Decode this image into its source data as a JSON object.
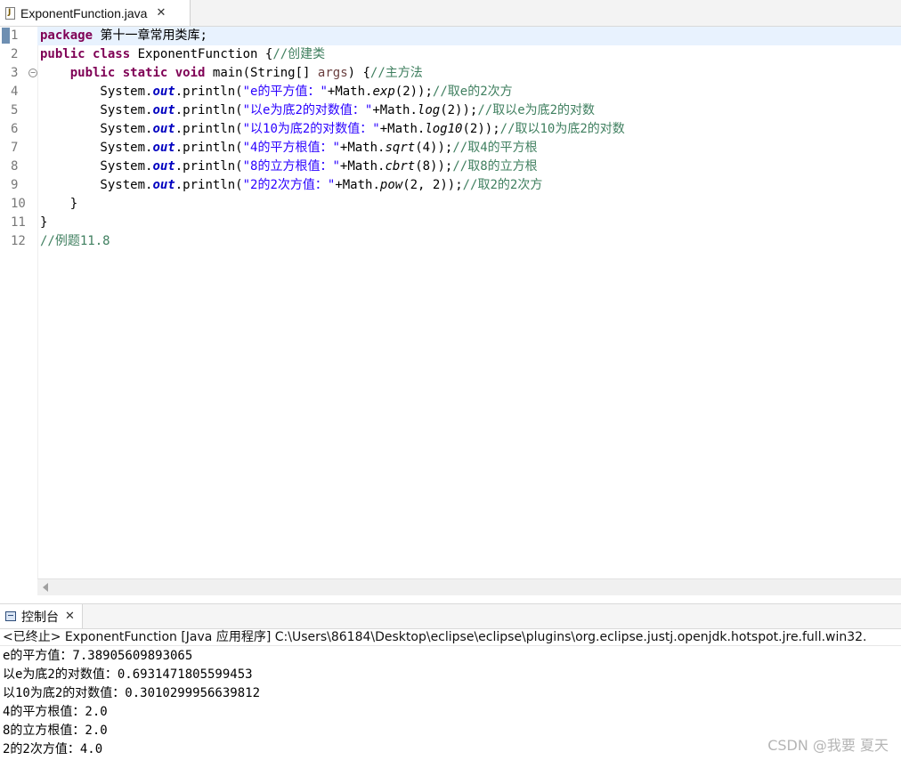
{
  "editor_tab": {
    "title": "ExponentFunction.java",
    "close": "✕"
  },
  "code_lines": [
    {
      "num": "1",
      "parts": [
        {
          "t": "package",
          "c": "kw"
        },
        {
          "t": " 第十一章常用类库;",
          "c": ""
        }
      ]
    },
    {
      "num": "2",
      "parts": [
        {
          "t": "public",
          "c": "kw"
        },
        {
          "t": " ",
          "c": ""
        },
        {
          "t": "class",
          "c": "kw"
        },
        {
          "t": " ExponentFunction {",
          "c": ""
        },
        {
          "t": "//创建类",
          "c": "cm"
        }
      ]
    },
    {
      "num": "3",
      "fold": true,
      "parts": [
        {
          "t": "    ",
          "c": ""
        },
        {
          "t": "public",
          "c": "kw"
        },
        {
          "t": " ",
          "c": ""
        },
        {
          "t": "static",
          "c": "kw"
        },
        {
          "t": " ",
          "c": ""
        },
        {
          "t": "void",
          "c": "kw"
        },
        {
          "t": " main(String[] ",
          "c": ""
        },
        {
          "t": "args",
          "c": "ar"
        },
        {
          "t": ") {",
          "c": ""
        },
        {
          "t": "//主方法",
          "c": "cm"
        }
      ]
    },
    {
      "num": "4",
      "parts": [
        {
          "t": "        System.",
          "c": ""
        },
        {
          "t": "out",
          "c": "fld"
        },
        {
          "t": ".println(",
          "c": ""
        },
        {
          "t": "\"e的平方值：\"",
          "c": "st"
        },
        {
          "t": "+Math.",
          "c": ""
        },
        {
          "t": "exp",
          "c": "it"
        },
        {
          "t": "(2));",
          "c": ""
        },
        {
          "t": "//取e的2次方",
          "c": "cm"
        }
      ]
    },
    {
      "num": "5",
      "parts": [
        {
          "t": "        System.",
          "c": ""
        },
        {
          "t": "out",
          "c": "fld"
        },
        {
          "t": ".println(",
          "c": ""
        },
        {
          "t": "\"以e为底2的对数值：\"",
          "c": "st"
        },
        {
          "t": "+Math.",
          "c": ""
        },
        {
          "t": "log",
          "c": "it"
        },
        {
          "t": "(2));",
          "c": ""
        },
        {
          "t": "//取以e为底2的对数",
          "c": "cm"
        }
      ]
    },
    {
      "num": "6",
      "parts": [
        {
          "t": "        System.",
          "c": ""
        },
        {
          "t": "out",
          "c": "fld"
        },
        {
          "t": ".println(",
          "c": ""
        },
        {
          "t": "\"以10为底2的对数值：\"",
          "c": "st"
        },
        {
          "t": "+Math.",
          "c": ""
        },
        {
          "t": "log10",
          "c": "it"
        },
        {
          "t": "(2));",
          "c": ""
        },
        {
          "t": "//取以10为底2的对数",
          "c": "cm"
        }
      ]
    },
    {
      "num": "7",
      "parts": [
        {
          "t": "        System.",
          "c": ""
        },
        {
          "t": "out",
          "c": "fld"
        },
        {
          "t": ".println(",
          "c": ""
        },
        {
          "t": "\"4的平方根值：\"",
          "c": "st"
        },
        {
          "t": "+Math.",
          "c": ""
        },
        {
          "t": "sqrt",
          "c": "it"
        },
        {
          "t": "(4));",
          "c": ""
        },
        {
          "t": "//取4的平方根",
          "c": "cm"
        }
      ]
    },
    {
      "num": "8",
      "parts": [
        {
          "t": "        System.",
          "c": ""
        },
        {
          "t": "out",
          "c": "fld"
        },
        {
          "t": ".println(",
          "c": ""
        },
        {
          "t": "\"8的立方根值：\"",
          "c": "st"
        },
        {
          "t": "+Math.",
          "c": ""
        },
        {
          "t": "cbrt",
          "c": "it"
        },
        {
          "t": "(8));",
          "c": ""
        },
        {
          "t": "//取8的立方根",
          "c": "cm"
        }
      ]
    },
    {
      "num": "9",
      "parts": [
        {
          "t": "        System.",
          "c": ""
        },
        {
          "t": "out",
          "c": "fld"
        },
        {
          "t": ".println(",
          "c": ""
        },
        {
          "t": "\"2的2次方值：\"",
          "c": "st"
        },
        {
          "t": "+Math.",
          "c": ""
        },
        {
          "t": "pow",
          "c": "it"
        },
        {
          "t": "(2, 2));",
          "c": ""
        },
        {
          "t": "//取2的2次方",
          "c": "cm"
        }
      ]
    },
    {
      "num": "10",
      "parts": [
        {
          "t": "    }",
          "c": ""
        }
      ]
    },
    {
      "num": "11",
      "parts": [
        {
          "t": "}",
          "c": ""
        }
      ]
    },
    {
      "num": "12",
      "parts": [
        {
          "t": "//例题11.8",
          "c": "cm"
        }
      ]
    }
  ],
  "console": {
    "tab_label": "控制台",
    "close": "✕",
    "description": "<已终止> ExponentFunction [Java 应用程序] C:\\Users\\86184\\Desktop\\eclipse\\eclipse\\plugins\\org.eclipse.justj.openjdk.hotspot.jre.full.win32.",
    "output": [
      "e的平方值：7.38905609893065",
      "以e为底2的对数值：0.6931471805599453",
      "以10为底2的对数值：0.3010299956639812",
      "4的平方根值：2.0",
      "8的立方根值：2.0",
      "2的2次方值：4.0"
    ]
  },
  "watermark": "CSDN @我要 夏天",
  "colors": {
    "keyword": "#7f0055",
    "comment": "#3f7f5f",
    "string": "#2a00ff",
    "field": "#0000c0",
    "current_line": "#e8f2fe"
  }
}
